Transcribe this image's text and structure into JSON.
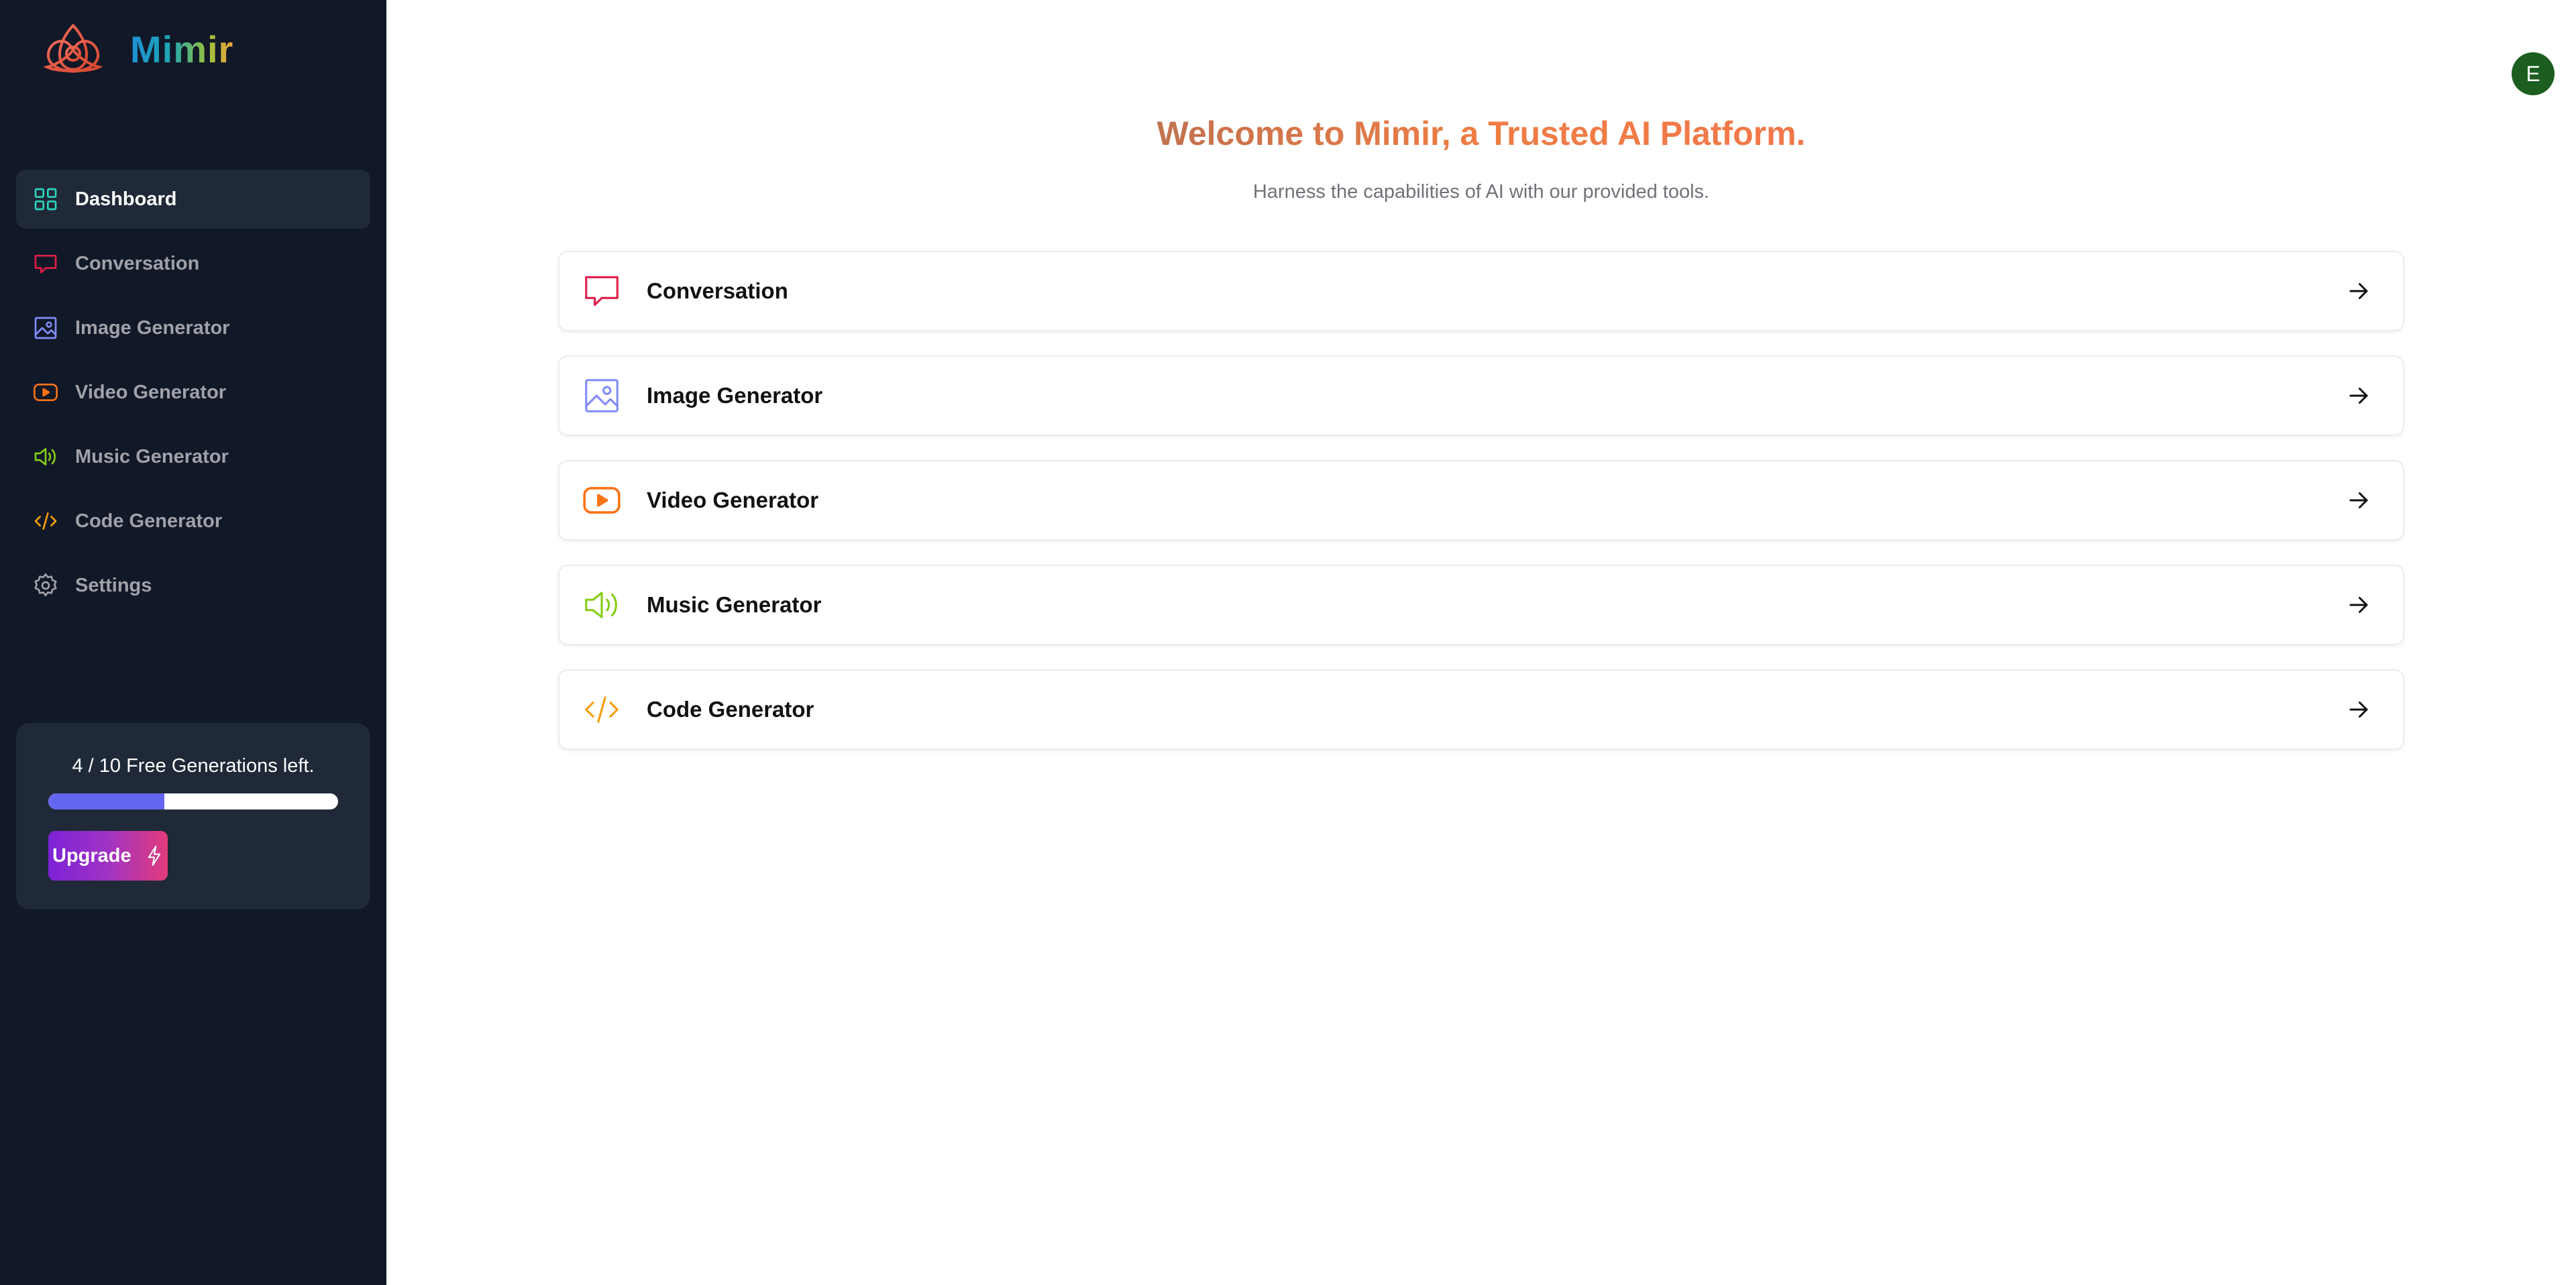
{
  "brand": {
    "name": "Mimir"
  },
  "sidebar": {
    "items": [
      {
        "label": "Dashboard",
        "icon": "dashboard-icon",
        "color": "#2dd4bf",
        "active": true
      },
      {
        "label": "Conversation",
        "icon": "chat-icon",
        "color": "#e11d48"
      },
      {
        "label": "Image Generator",
        "icon": "image-icon",
        "color": "#818cf8"
      },
      {
        "label": "Video Generator",
        "icon": "video-icon",
        "color": "#f97316"
      },
      {
        "label": "Music Generator",
        "icon": "music-icon",
        "color": "#84cc16"
      },
      {
        "label": "Code Generator",
        "icon": "code-icon",
        "color": "#f59e0b"
      },
      {
        "label": "Settings",
        "icon": "gear-icon",
        "color": "#a1a1aa"
      }
    ]
  },
  "credits": {
    "text": "4 / 10 Free Generations left.",
    "used": 4,
    "total": 10,
    "upgrade_label": "Upgrade",
    "progress_color": "#6366f1"
  },
  "user": {
    "initial": "E",
    "avatar_color": "#1b5e20"
  },
  "main": {
    "title": "Welcome to Mimir, a Trusted AI Platform.",
    "subtitle": "Harness the capabilities of AI with our provided tools.",
    "tools": [
      {
        "label": "Conversation",
        "icon": "chat-icon",
        "color": "#e11d48"
      },
      {
        "label": "Image Generator",
        "icon": "image-icon",
        "color": "#818cf8"
      },
      {
        "label": "Video Generator",
        "icon": "video-icon",
        "color": "#f97316"
      },
      {
        "label": "Music Generator",
        "icon": "music-icon",
        "color": "#84cc16"
      },
      {
        "label": "Code Generator",
        "icon": "code-icon",
        "color": "#f59e0b"
      }
    ]
  }
}
